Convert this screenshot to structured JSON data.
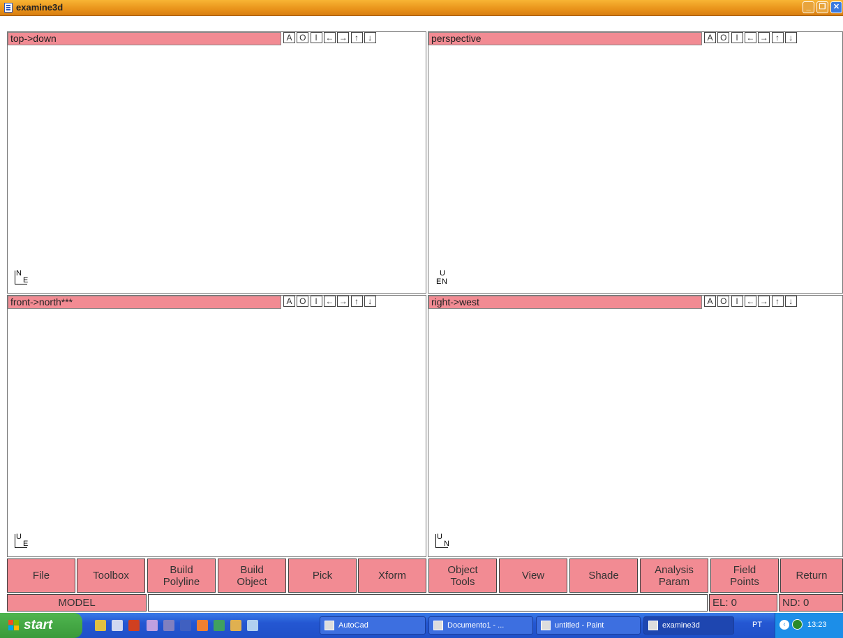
{
  "window": {
    "title": "examine3d",
    "min_glyph": "_",
    "max_glyph": "❐",
    "close_glyph": "✕"
  },
  "viewport_buttons": [
    "A",
    "O",
    "I",
    "←",
    "→",
    "↑",
    "↓"
  ],
  "views": [
    {
      "title": "top->down",
      "axis": {
        "v": "N",
        "h": "E"
      }
    },
    {
      "title": "perspective",
      "axis": {
        "v": "U",
        "h": "E",
        "h2": "N"
      }
    },
    {
      "title": "front->north***",
      "axis": {
        "v": "U",
        "h": "E"
      }
    },
    {
      "title": "right->west",
      "axis": {
        "v": "U",
        "h": "N"
      }
    }
  ],
  "menu": [
    {
      "label": "File"
    },
    {
      "label": "Toolbox"
    },
    {
      "label": "Build\nPolyline"
    },
    {
      "label": "Build\nObject"
    },
    {
      "label": "Pick"
    },
    {
      "label": "Xform"
    },
    {
      "label": "Object\nTools"
    },
    {
      "label": "View"
    },
    {
      "label": "Shade"
    },
    {
      "label": "Analysis\nParam"
    },
    {
      "label": "Field\nPoints"
    },
    {
      "label": "Return"
    }
  ],
  "status": {
    "mode": "MODEL",
    "command_value": "",
    "el": "EL: 0",
    "nd": "ND: 0"
  },
  "taskbar": {
    "start": "start",
    "tasks": [
      "AutoCad",
      "Documento1 - ...",
      "untitled - Paint",
      "examine3d"
    ],
    "language": "PT",
    "time": "13:23"
  },
  "colors": {
    "pane_header": "#f28b93",
    "titlebar": "#e8921a",
    "taskbar": "#2457d2"
  }
}
